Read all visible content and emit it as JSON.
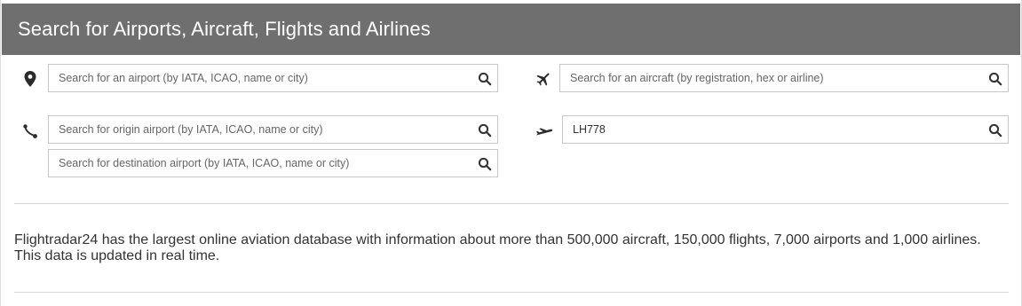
{
  "header": {
    "title": "Search for Airports, Aircraft, Flights and Airlines"
  },
  "search": {
    "airport": {
      "placeholder": "Search for an airport (by IATA, ICAO, name or city)",
      "value": ""
    },
    "aircraft": {
      "placeholder": "Search for an aircraft (by registration, hex or airline)",
      "value": ""
    },
    "origin": {
      "placeholder": "Search for origin airport (by IATA, ICAO, name or city)",
      "value": ""
    },
    "destination": {
      "placeholder": "Search for destination airport (by IATA, ICAO, name or city)",
      "value": ""
    },
    "flight": {
      "placeholder": "",
      "value": "LH778"
    }
  },
  "icons": {
    "airport": "map-pin-icon",
    "aircraft": "airplane-icon",
    "route": "route-icon",
    "flight": "flight-takeoff-icon",
    "search": "search-icon"
  },
  "description": "Flightradar24 has the largest online aviation database with information about more than 500,000 aircraft, 150,000 flights, 7,000 airports and 1,000 airlines. This data is updated in real time.",
  "colors": {
    "header_bg": "#6f6f6f",
    "header_text": "#ffffff",
    "border": "#c8c8c8"
  }
}
